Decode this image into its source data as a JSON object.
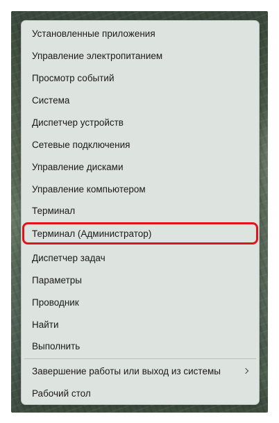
{
  "context_menu": {
    "items": [
      {
        "label": "Установленные приложения"
      },
      {
        "label": "Управление электропитанием"
      },
      {
        "label": "Просмотр событий"
      },
      {
        "label": "Система"
      },
      {
        "label": "Диспетчер устройств"
      },
      {
        "label": "Сетевые подключения"
      },
      {
        "label": "Управление дисками"
      },
      {
        "label": "Управление компьютером"
      },
      {
        "label": "Терминал"
      },
      {
        "label": "Терминал (Администратор)",
        "highlighted": true
      },
      {
        "label": "Диспетчер задач"
      },
      {
        "label": "Параметры"
      },
      {
        "label": "Проводник"
      },
      {
        "label": "Найти"
      },
      {
        "label": "Выполнить"
      },
      {
        "label": "Завершение работы или выход из системы",
        "submenu": true,
        "icon": "chevron-right-icon"
      },
      {
        "label": "Рабочий стол"
      }
    ]
  },
  "colors": {
    "menu_background": "#dde3de",
    "highlight_border": "#e0141c",
    "text": "#1a1a1a"
  }
}
